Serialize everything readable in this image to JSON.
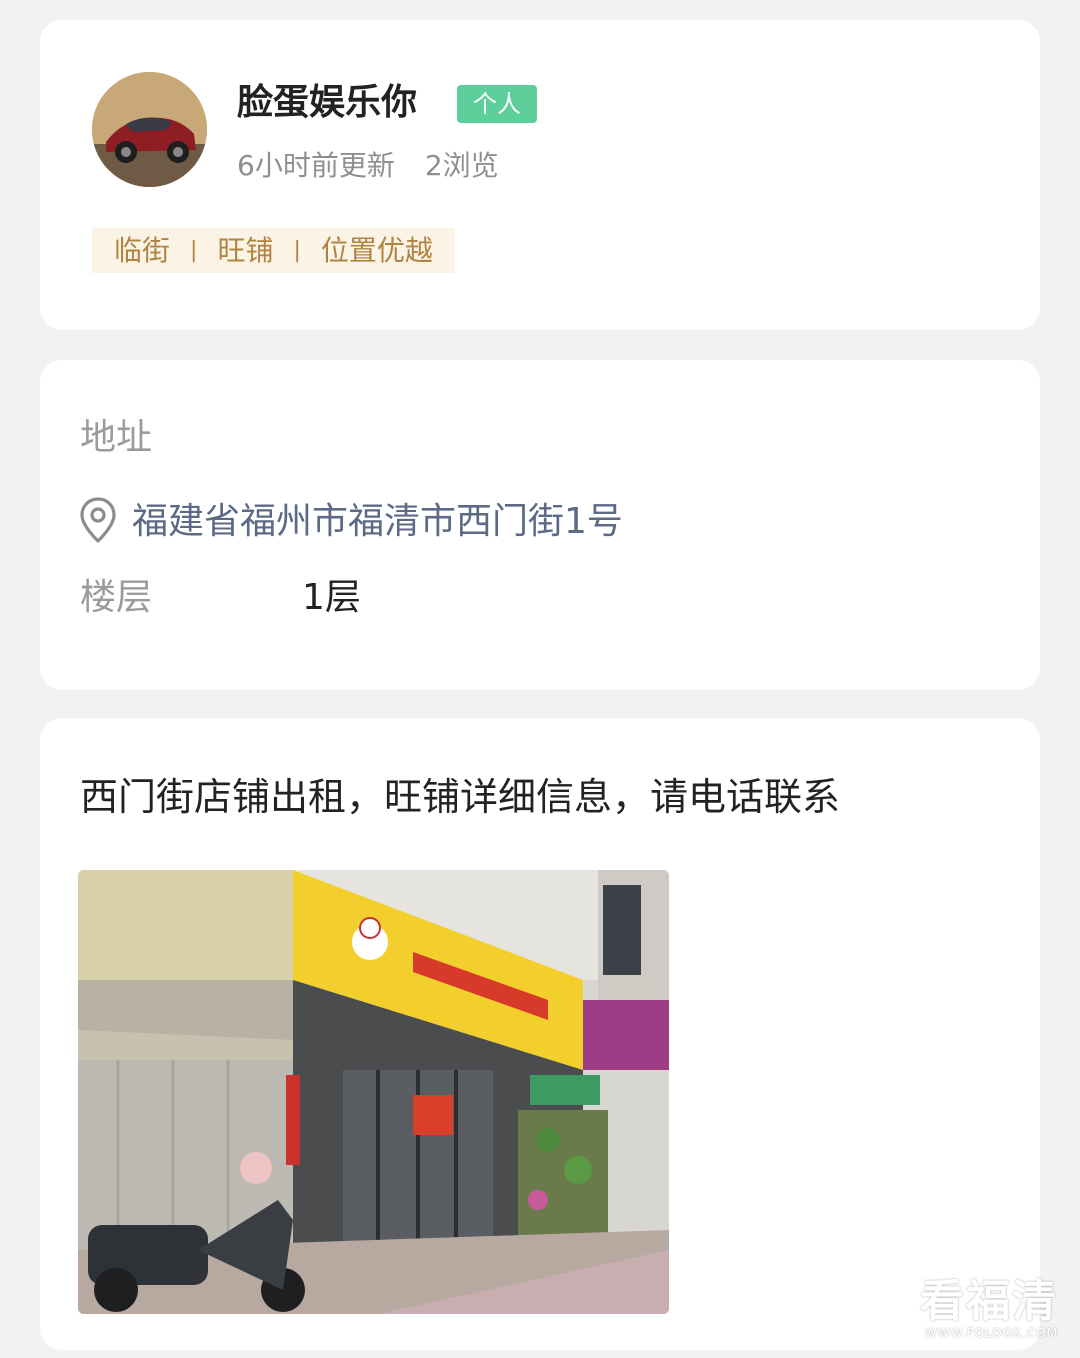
{
  "profile": {
    "name": "脸蛋娱乐你",
    "badge": "个人",
    "updated": "6小时前更新",
    "views": "2浏览",
    "tags": [
      "临街",
      "旺铺",
      "位置优越"
    ],
    "tag_separator": "|"
  },
  "address": {
    "label": "地址",
    "icon": "location-pin-icon",
    "value": "福建省福州市福清市西门街1号",
    "floor_label": "楼层",
    "floor_value": "1层"
  },
  "description": {
    "text": "西门街店铺出租，旺铺详细信息，请电话联系"
  },
  "watermark": {
    "main": "看福清",
    "sub": "WWW.FQLOOK.COM"
  },
  "colors": {
    "badge": "#5ccf9b",
    "tag_text": "#b08440",
    "tag_bg": "#fbf4e6",
    "address_text": "#5d6a86"
  }
}
